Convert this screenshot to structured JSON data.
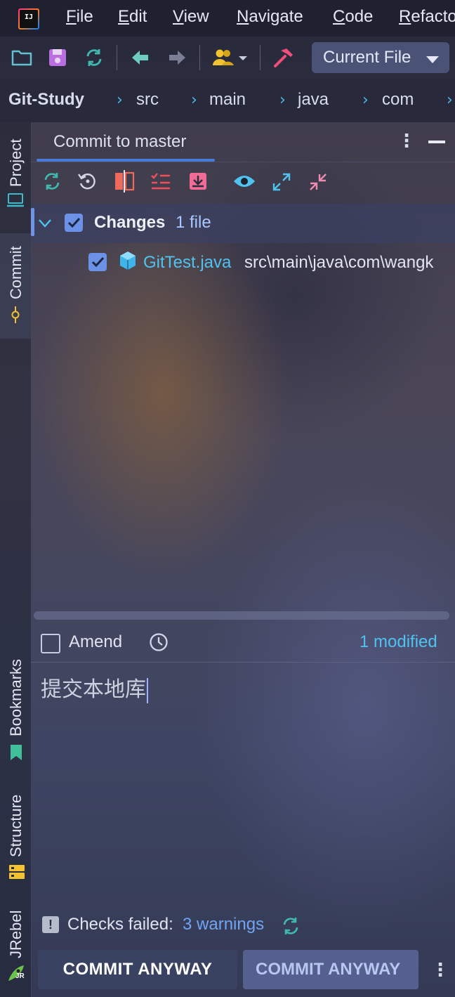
{
  "menubar": {
    "items": [
      {
        "mnemonic": "F",
        "rest": "ile"
      },
      {
        "mnemonic": "E",
        "rest": "dit"
      },
      {
        "mnemonic": "V",
        "rest": "iew"
      },
      {
        "mnemonic": "N",
        "rest": "avigate"
      },
      {
        "mnemonic": "C",
        "rest": "ode"
      },
      {
        "mnemonic": "R",
        "rest": "efacto"
      }
    ],
    "logo_text": "IJ"
  },
  "toolbar": {
    "run_config": "Current File",
    "icons": [
      "open-folder-icon",
      "save-icon",
      "sync-icon",
      "back-arrow-icon",
      "forward-arrow-icon",
      "vcs-users-icon",
      "build-hammer-icon"
    ]
  },
  "breadcrumb": {
    "items": [
      "Git-Study",
      "src",
      "main",
      "java",
      "com"
    ]
  },
  "leftstrip": {
    "project": "Project",
    "commit": "Commit",
    "bookmarks": "Bookmarks",
    "structure": "Structure",
    "jrebel": "JRebel",
    "jrebel_badge": "JR"
  },
  "commit_panel": {
    "tab_title": "Commit to master",
    "changes_label": "Changes",
    "changes_count": "1 file",
    "file": {
      "name": "GitTest.java",
      "path": "src\\main\\java\\com\\wangk"
    },
    "amend_label": "Amend",
    "modified_label": "1 modified",
    "message": "提交本地库",
    "checks_label": "Checks failed:",
    "checks_link": "3 warnings",
    "warn_glyph": "!",
    "commit_button": "COMMIT ANYWAY",
    "commit_button_2": "COMMIT ANYWAY"
  },
  "colors": {
    "accent": "#4b7bd8",
    "link": "#4fc3f0",
    "checkbox": "#6b92e6"
  }
}
